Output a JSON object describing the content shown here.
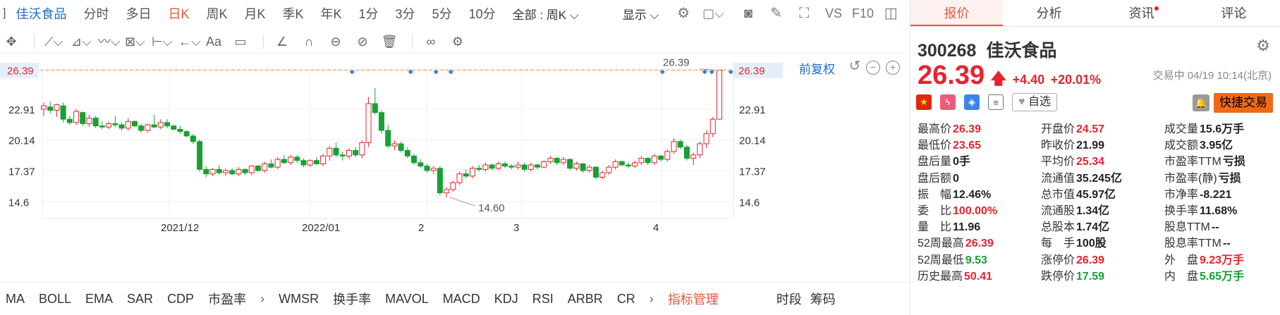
{
  "toolbar1": {
    "name": "佳沃食品",
    "periods": [
      "分时",
      "多日",
      "日K",
      "周K",
      "月K",
      "季K",
      "年K",
      "1分",
      "3分",
      "5分",
      "10分"
    ],
    "selected": "日K",
    "all_week": "全部 : 周K",
    "display": "显示",
    "vs": "VS",
    "f10": "F10"
  },
  "chart_top": {
    "fuquan": "前复权"
  },
  "chart_data": {
    "type": "candlestick",
    "title": "",
    "yticks": [
      14.6,
      17.37,
      20.14,
      22.91
    ],
    "ylim": [
      13.1,
      26.5
    ],
    "current_price": 26.39,
    "current_label": "26.39",
    "high_label": "26.39",
    "low_label": "14.60",
    "xlabels": [
      "2021/12",
      "2022/01",
      "2",
      "3",
      "4"
    ],
    "candles": [
      [
        22.9,
        23.5,
        22.3,
        23.2
      ],
      [
        23.1,
        23.6,
        22.5,
        22.8
      ],
      [
        22.8,
        23.4,
        22.2,
        23.3
      ],
      [
        23.2,
        23.5,
        21.7,
        22.0
      ],
      [
        22.0,
        22.3,
        21.5,
        21.7
      ],
      [
        21.7,
        22.9,
        21.5,
        22.7
      ],
      [
        22.6,
        22.7,
        21.4,
        21.6
      ],
      [
        21.6,
        22.4,
        21.3,
        22.1
      ],
      [
        22.1,
        22.3,
        21.2,
        21.4
      ],
      [
        21.4,
        21.8,
        21.1,
        21.3
      ],
      [
        21.3,
        21.8,
        21.1,
        21.6
      ],
      [
        21.6,
        22.3,
        21.3,
        21.5
      ],
      [
        21.5,
        21.7,
        21.0,
        21.2
      ],
      [
        21.2,
        22.1,
        21.0,
        21.8
      ],
      [
        21.8,
        21.9,
        21.3,
        21.4
      ],
      [
        21.4,
        21.6,
        20.8,
        21.0
      ],
      [
        21.0,
        21.6,
        20.8,
        21.5
      ],
      [
        21.5,
        22.4,
        21.2,
        21.3
      ],
      [
        21.3,
        22.0,
        21.1,
        21.7
      ],
      [
        21.7,
        22.0,
        21.2,
        21.4
      ],
      [
        21.4,
        21.5,
        21.0,
        21.1
      ],
      [
        21.1,
        21.4,
        20.7,
        20.9
      ],
      [
        20.9,
        21.0,
        20.4,
        20.5
      ],
      [
        20.5,
        20.7,
        19.8,
        20.0
      ],
      [
        20.0,
        20.2,
        17.3,
        17.5
      ],
      [
        17.5,
        17.8,
        16.8,
        17.1
      ],
      [
        17.1,
        17.6,
        16.9,
        17.5
      ],
      [
        17.5,
        17.9,
        17.0,
        17.2
      ],
      [
        17.2,
        17.6,
        16.9,
        17.4
      ],
      [
        17.4,
        17.6,
        17.0,
        17.1
      ],
      [
        17.1,
        17.7,
        16.9,
        17.5
      ],
      [
        17.5,
        17.6,
        17.0,
        17.2
      ],
      [
        17.2,
        17.9,
        17.0,
        17.8
      ],
      [
        17.8,
        17.9,
        17.3,
        17.4
      ],
      [
        17.4,
        18.2,
        17.2,
        18.0
      ],
      [
        18.0,
        18.4,
        17.6,
        17.7
      ],
      [
        17.7,
        18.6,
        17.5,
        18.4
      ],
      [
        18.4,
        18.8,
        18.0,
        18.1
      ],
      [
        18.1,
        18.8,
        17.9,
        18.6
      ],
      [
        18.6,
        18.8,
        18.1,
        18.3
      ],
      [
        18.3,
        18.5,
        17.7,
        17.9
      ],
      [
        17.9,
        18.4,
        17.7,
        18.3
      ],
      [
        18.3,
        18.6,
        17.9,
        18.0
      ],
      [
        18.0,
        18.9,
        17.8,
        18.7
      ],
      [
        18.7,
        19.6,
        18.3,
        19.4
      ],
      [
        19.4,
        19.9,
        18.6,
        18.8
      ],
      [
        18.8,
        19.1,
        18.3,
        18.7
      ],
      [
        18.7,
        19.4,
        18.4,
        19.2
      ],
      [
        19.2,
        19.5,
        18.6,
        18.8
      ],
      [
        18.8,
        20.1,
        18.5,
        19.9
      ],
      [
        19.9,
        24.0,
        19.5,
        23.4
      ],
      [
        23.4,
        24.8,
        22.4,
        22.6
      ],
      [
        22.6,
        22.8,
        20.7,
        21.0
      ],
      [
        21.0,
        21.5,
        19.4,
        19.6
      ],
      [
        19.6,
        20.1,
        19.2,
        19.8
      ],
      [
        19.8,
        20.0,
        19.0,
        19.2
      ],
      [
        19.2,
        19.5,
        18.5,
        18.7
      ],
      [
        18.7,
        18.9,
        17.9,
        18.1
      ],
      [
        18.1,
        18.4,
        17.6,
        17.8
      ],
      [
        17.8,
        18.0,
        17.2,
        17.4
      ],
      [
        17.4,
        17.8,
        17.1,
        17.6
      ],
      [
        17.6,
        17.8,
        15.2,
        15.4
      ],
      [
        15.4,
        15.9,
        15.0,
        15.7
      ],
      [
        15.7,
        16.5,
        15.5,
        16.3
      ],
      [
        16.3,
        17.3,
        16.1,
        17.1
      ],
      [
        17.1,
        17.5,
        16.7,
        16.9
      ],
      [
        16.9,
        17.8,
        16.7,
        17.6
      ],
      [
        17.6,
        17.9,
        17.3,
        17.5
      ],
      [
        17.5,
        18.1,
        17.3,
        17.9
      ],
      [
        17.9,
        18.0,
        17.4,
        17.6
      ],
      [
        17.6,
        18.2,
        17.4,
        18.0
      ],
      [
        18.0,
        18.2,
        17.6,
        17.8
      ],
      [
        17.8,
        18.0,
        17.5,
        17.7
      ],
      [
        17.7,
        18.2,
        17.5,
        17.9
      ],
      [
        17.9,
        18.1,
        17.3,
        17.5
      ],
      [
        17.5,
        18.1,
        17.3,
        17.9
      ],
      [
        17.9,
        18.0,
        17.5,
        17.7
      ],
      [
        17.7,
        18.3,
        17.6,
        18.2
      ],
      [
        18.2,
        18.7,
        18.0,
        18.5
      ],
      [
        18.5,
        18.6,
        17.9,
        18.1
      ],
      [
        18.1,
        18.6,
        17.9,
        18.4
      ],
      [
        18.4,
        18.5,
        17.4,
        17.6
      ],
      [
        17.6,
        18.2,
        17.4,
        18.0
      ],
      [
        18.0,
        18.1,
        17.2,
        17.4
      ],
      [
        17.4,
        17.9,
        17.2,
        17.7
      ],
      [
        17.7,
        17.8,
        16.6,
        16.8
      ],
      [
        16.8,
        17.4,
        16.6,
        17.2
      ],
      [
        17.2,
        17.9,
        17.0,
        17.7
      ],
      [
        17.7,
        18.4,
        17.5,
        18.2
      ],
      [
        18.2,
        18.3,
        17.8,
        17.9
      ],
      [
        17.9,
        18.1,
        17.6,
        17.8
      ],
      [
        17.8,
        18.3,
        17.6,
        18.1
      ],
      [
        18.1,
        18.7,
        17.9,
        18.5
      ],
      [
        18.5,
        18.6,
        17.9,
        18.1
      ],
      [
        18.1,
        18.9,
        17.9,
        18.7
      ],
      [
        18.7,
        18.8,
        18.2,
        18.4
      ],
      [
        18.4,
        19.3,
        18.2,
        19.1
      ],
      [
        19.1,
        20.3,
        18.9,
        20.0
      ],
      [
        20.0,
        20.2,
        19.3,
        19.5
      ],
      [
        19.5,
        19.7,
        18.3,
        18.5
      ],
      [
        18.5,
        19.0,
        17.9,
        18.8
      ],
      [
        18.8,
        20.0,
        18.5,
        19.8
      ],
      [
        19.8,
        21.0,
        19.4,
        20.7
      ],
      [
        20.7,
        22.2,
        20.4,
        22.0
      ],
      [
        22.0,
        26.39,
        22.0,
        26.39
      ]
    ],
    "markers_x": [
      500,
      583,
      619,
      640,
      940,
      1000,
      1010,
      1037,
      1047,
      1067,
      1077
    ]
  },
  "indicators": {
    "items": [
      "MA",
      "BOLL",
      "EMA",
      "SAR",
      "CDP",
      "市盈率",
      "WMSR",
      "换手率",
      "MAVOL",
      "MACD",
      "KDJ",
      "RSI",
      "ARBR",
      "CR"
    ],
    "manager": "指标管理",
    "timeseg": "时段",
    "chips": "筹码"
  },
  "right": {
    "tabs": [
      "报价",
      "分析",
      "资讯",
      "评论"
    ],
    "code": "300268",
    "name": "佳沃食品",
    "price": "26.39",
    "change": "+4.40",
    "change_pct": "+20.01%",
    "status": "交易中 04/19 10:14(北京)",
    "watch": "自选",
    "trade": "快捷交易",
    "rows": [
      [
        [
          "最高价",
          "26.39",
          "red"
        ],
        [
          "开盘价",
          "24.57",
          "red"
        ],
        [
          "成交量",
          "15.6万手",
          "blk"
        ]
      ],
      [
        [
          "最低价",
          "23.65",
          "red"
        ],
        [
          "昨收价",
          "21.99",
          "blk"
        ],
        [
          "成交额",
          "3.95亿",
          "blk"
        ]
      ],
      [
        [
          "盘后量",
          "0手",
          "blk"
        ],
        [
          "平均价",
          "25.34",
          "red"
        ],
        [
          "市盈率TTM",
          "亏损",
          "blk"
        ]
      ],
      [
        [
          "盘后额",
          "0",
          "blk"
        ],
        [
          "流通值",
          "35.245亿",
          "blk"
        ],
        [
          "市盈率(静)",
          "亏损",
          "blk"
        ]
      ],
      [
        [
          "振　幅",
          "12.46%",
          "blk"
        ],
        [
          "总市值",
          "45.97亿",
          "blk"
        ],
        [
          "市净率",
          "-8.221",
          "blk"
        ]
      ],
      [
        [
          "委　比",
          "100.00%",
          "red"
        ],
        [
          "流通股",
          "1.34亿",
          "blk"
        ],
        [
          "换手率",
          "11.68%",
          "blk"
        ]
      ],
      [
        [
          "量　比",
          "11.96",
          "blk"
        ],
        [
          "总股本",
          "1.74亿",
          "blk"
        ],
        [
          "股息TTM",
          "--",
          "blk"
        ]
      ],
      [
        [
          "52周最高",
          "26.39",
          "red"
        ],
        [
          "每　手",
          "100股",
          "blk"
        ],
        [
          "股息率TTM",
          "--",
          "blk"
        ]
      ],
      [
        [
          "52周最低",
          "9.53",
          "grn"
        ],
        [
          "涨停价",
          "26.39",
          "red"
        ],
        [
          "外　盘",
          "9.23万手",
          "red"
        ]
      ],
      [
        [
          "历史最高",
          "50.41",
          "red"
        ],
        [
          "跌停价",
          "17.59",
          "grn"
        ],
        [
          "内　盘",
          "5.65万手",
          "grn"
        ]
      ]
    ]
  }
}
